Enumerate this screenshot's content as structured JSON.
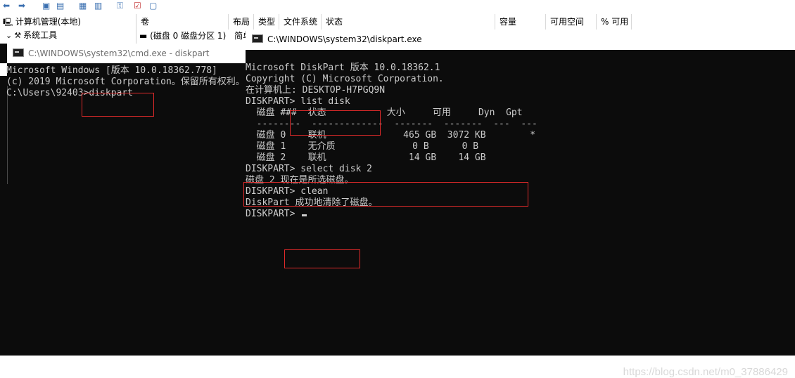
{
  "mmc": {
    "tree": [
      {
        "label": "计算机管理(本地)"
      },
      {
        "label": "系统工具"
      }
    ],
    "volume_columns": [
      "卷",
      "布局",
      "类型",
      "文件系统",
      "状态",
      "容量",
      "可用空间",
      "% 可用"
    ],
    "volume_row": "(磁盘 0 磁盘分区 1)",
    "volume_row_layout": "简单"
  },
  "cmd_window": {
    "title": "C:\\WINDOWS\\system32\\cmd.exe - diskpart",
    "lines": [
      "Microsoft Windows [版本 10.0.18362.778]",
      "(c) 2019 Microsoft Corporation。保留所有权利。",
      "",
      "C:\\Users\\92403>diskpart"
    ]
  },
  "diskpart_window": {
    "title": "C:\\WINDOWS\\system32\\diskpart.exe",
    "lines": [
      "Microsoft DiskPart 版本 10.0.18362.1",
      "",
      "Copyright (C) Microsoft Corporation.",
      "在计算机上: DESKTOP-H7PGQ9N",
      "",
      "DISKPART> list disk",
      "",
      "  磁盘 ###  状态           大小     可用     Dyn  Gpt",
      "  --------  -------------  -------  -------  ---  ---",
      "  磁盘 0    联机              465 GB  3072 KB        *",
      "  磁盘 1    无介质              0 B      0 B",
      "  磁盘 2    联机               14 GB    14 GB",
      "",
      "DISKPART> select disk 2",
      "",
      "磁盘 2 现在是所选磁盘。",
      "",
      "DISKPART> clean",
      "",
      "DiskPart 成功地清除了磁盘。",
      "",
      "DISKPART> "
    ]
  },
  "watermark": "https://blog.csdn.net/m0_37886429"
}
